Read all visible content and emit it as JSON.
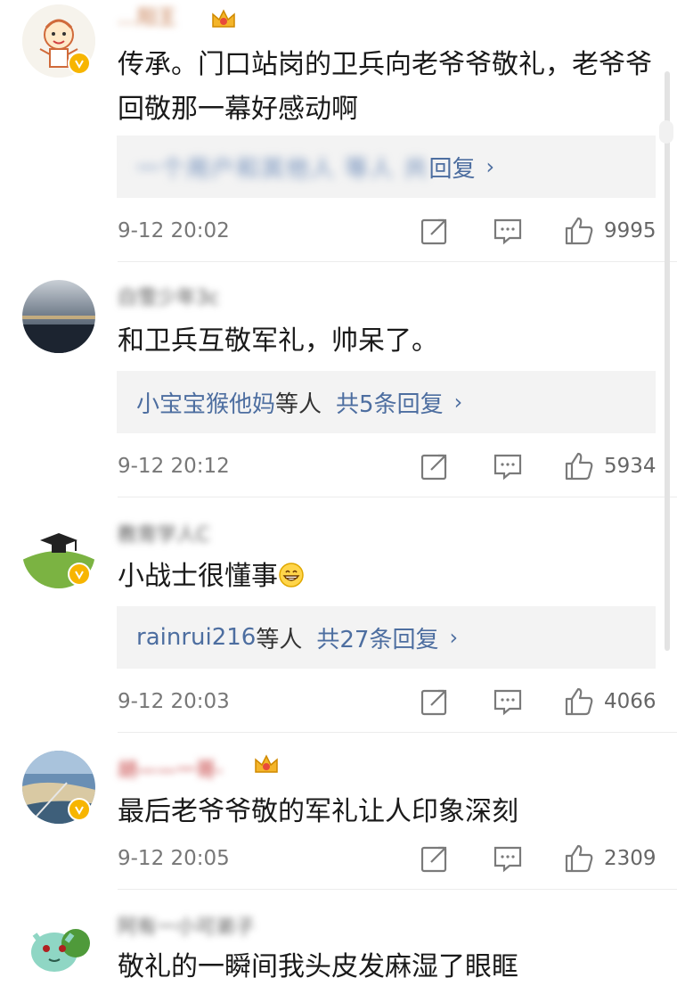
{
  "comments": [
    {
      "username": "…阳王",
      "text": "传承。门口站岗的卫兵向老爷爷敬礼，老爷爷回敬那一幕好感动啊",
      "reply_preview": "一个用户和其他人 等人 共",
      "reply_tail": "回复",
      "time": "9-12 20:02",
      "likes": "9995"
    },
    {
      "username": "白雪少年3c",
      "text": "和卫兵互敬军礼，帅呆了。",
      "reply_user": "小宝宝猴他妈",
      "reply_mid": "等人",
      "reply_count": "共5条回复",
      "time": "9-12 20:12",
      "likes": "5934"
    },
    {
      "username": "教育学人C",
      "text": "小战士很懂事",
      "reply_user": "rainrui216",
      "reply_mid": "等人",
      "reply_count": "共27条回复",
      "time": "9-12 20:03",
      "likes": "4066"
    },
    {
      "username": "胡——一哥-",
      "text": "最后老爷爷敬的军礼让人印象深刻",
      "time": "9-12 20:05",
      "likes": "2309"
    },
    {
      "username": "阿有一小可弟子",
      "text": "敬礼的一瞬间我头皮发麻湿了眼眶"
    }
  ],
  "colors": {
    "link": "#4d6ea0",
    "badge": "#f7b500",
    "reply_bg": "#f3f3f3"
  },
  "icons": [
    "share-icon",
    "comment-icon",
    "thumbs-up-icon",
    "chevron-right-icon",
    "verified-badge-icon",
    "crown-icon"
  ]
}
